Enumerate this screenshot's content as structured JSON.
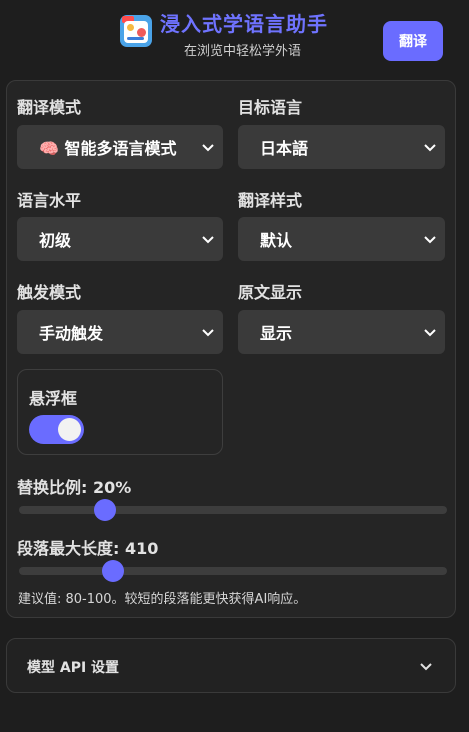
{
  "header": {
    "title": "浸入式学语言助手",
    "subtitle": "在浏览中轻松学外语",
    "translate_button": "翻译",
    "logo_icon": "app-logo-icon",
    "accent_color": "#6a6cff"
  },
  "settings": {
    "translation_mode": {
      "label": "翻译模式",
      "value": "🧠 智能多语言模式"
    },
    "target_language": {
      "label": "目标语言",
      "value": "日本語"
    },
    "language_level": {
      "label": "语言水平",
      "value": "初级"
    },
    "translation_style": {
      "label": "翻译样式",
      "value": "默认"
    },
    "trigger_mode": {
      "label": "触发模式",
      "value": "手动触发"
    },
    "original_display": {
      "label": "原文显示",
      "value": "显示"
    },
    "floating_box": {
      "label": "悬浮框",
      "enabled": true
    },
    "replacement_ratio": {
      "label": "替换比例: 20%",
      "percent": 20
    },
    "max_paragraph_length": {
      "label": "段落最大长度: 410",
      "fraction": 0.22
    },
    "hint": "建议值: 80-100。较短的段落能更快获得AI响应。"
  },
  "model_section": {
    "title": "模型 API 设置",
    "icon": "chevron-down-icon"
  }
}
